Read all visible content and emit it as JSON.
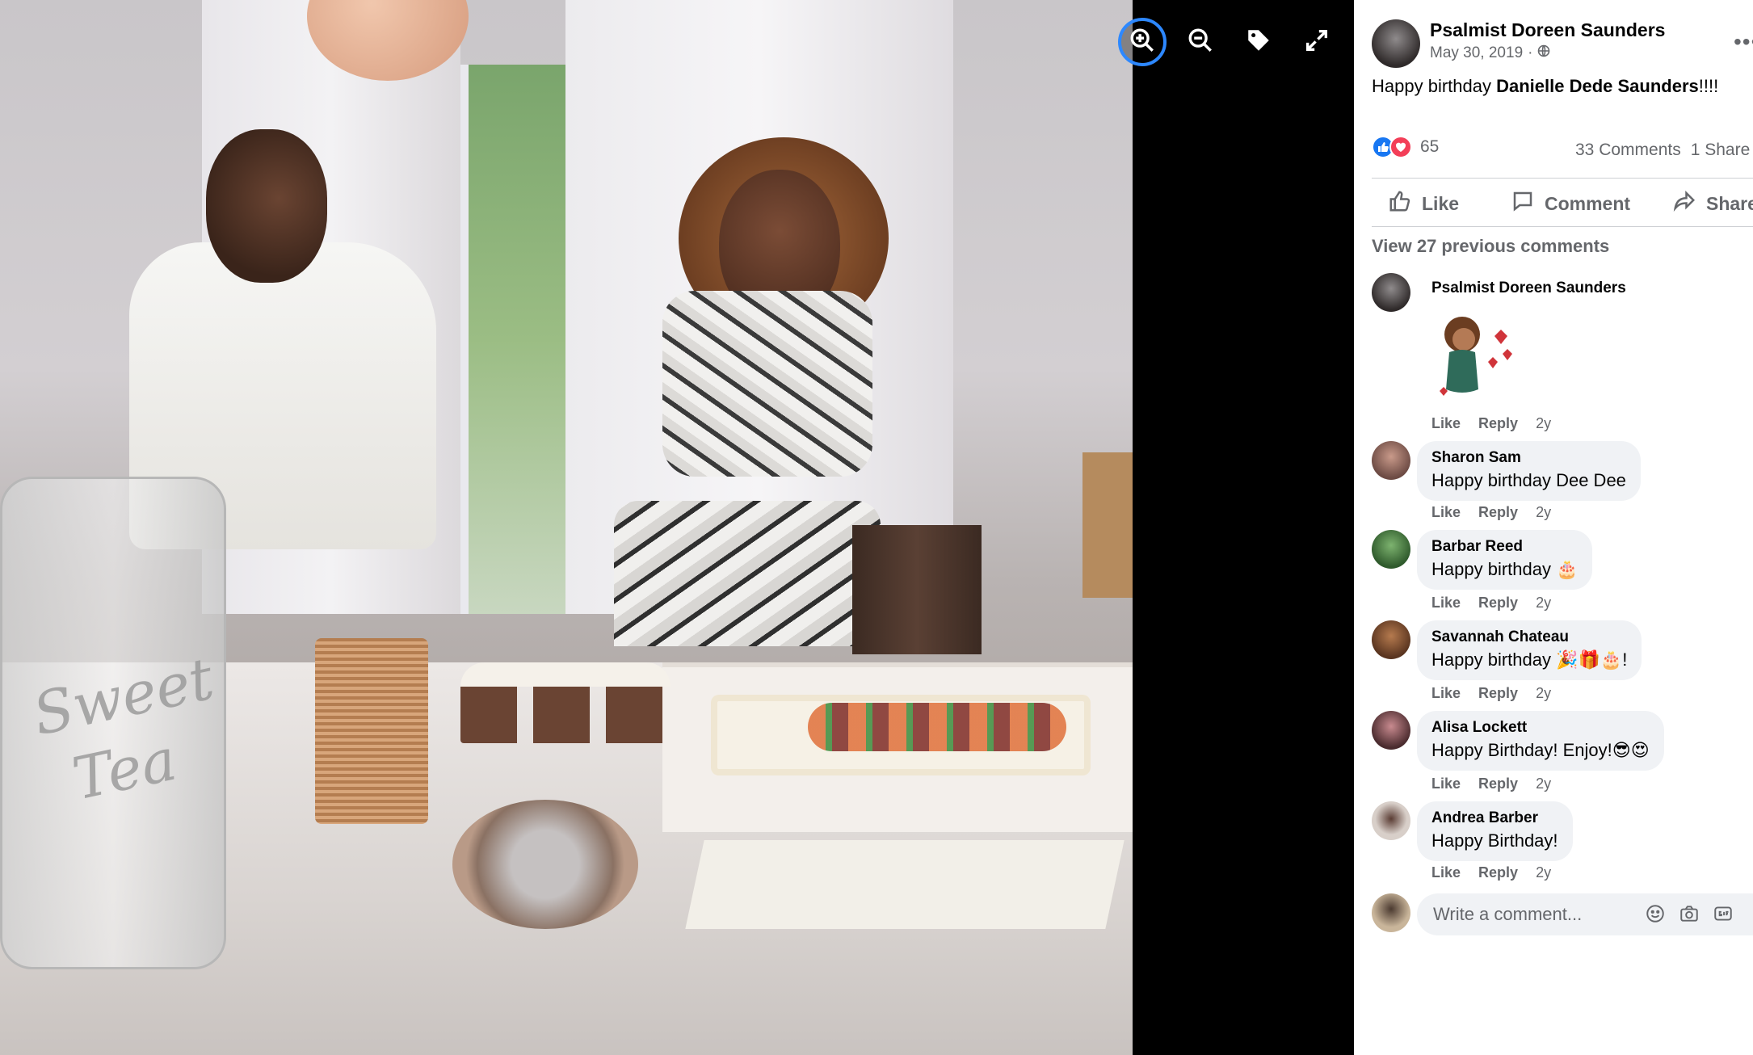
{
  "viewer": {
    "toolbar": [
      {
        "name": "zoom-in-icon",
        "active": true
      },
      {
        "name": "zoom-out-icon",
        "active": false
      },
      {
        "name": "tag-icon",
        "active": false
      },
      {
        "name": "fullscreen-icon",
        "active": false
      }
    ],
    "photo_text": {
      "jar_line1": "Sweet",
      "jar_line2": "Tea"
    }
  },
  "post": {
    "author": "Psalmist Doreen Saunders",
    "date": "May 30, 2019",
    "separator": "·",
    "privacy_icon": "globe-icon",
    "more_icon": "more-icon",
    "text_prefix": "Happy birthday ",
    "text_mention": "Danielle Dede Saunders",
    "text_suffix": "!!!!",
    "reaction_icons": [
      "like-reaction-icon",
      "love-reaction-icon"
    ],
    "reaction_count": "65",
    "comments_count": "33 Comments",
    "shares_count": "1 Share"
  },
  "actions": {
    "like": "Like",
    "comment": "Comment",
    "share": "Share"
  },
  "view_previous": "View 27 previous comments",
  "comments": [
    {
      "name": "Psalmist Doreen Saunders",
      "text": "",
      "sticker": true,
      "like": "Like",
      "reply": "Reply",
      "time": "2y"
    },
    {
      "name": "Sharon Sam",
      "text": "Happy birthday Dee Dee",
      "like": "Like",
      "reply": "Reply",
      "time": "2y"
    },
    {
      "name": "Barbar Reed",
      "text": "Happy birthday 🎂",
      "like": "Like",
      "reply": "Reply",
      "time": "2y"
    },
    {
      "name": "Savannah Chateau",
      "text": "Happy birthday 🎉🎁🎂!",
      "like": "Like",
      "reply": "Reply",
      "time": "2y"
    },
    {
      "name": "Alisa Lockett",
      "text": "Happy Birthday! Enjoy!😎😍",
      "like": "Like",
      "reply": "Reply",
      "time": "2y"
    },
    {
      "name": "Andrea Barber",
      "text": "Happy Birthday!",
      "like": "Like",
      "reply": "Reply",
      "time": "2y"
    }
  ],
  "composer": {
    "placeholder": "Write a comment...",
    "icons": [
      "emoji-icon",
      "camera-icon",
      "gif-icon",
      "sticker-icon"
    ]
  },
  "colors": {
    "accent": "#2d88ff",
    "like_blue": "#1877f2",
    "love_red": "#f33e58",
    "secondary_text": "#65676b",
    "bubble": "#f0f2f5"
  }
}
